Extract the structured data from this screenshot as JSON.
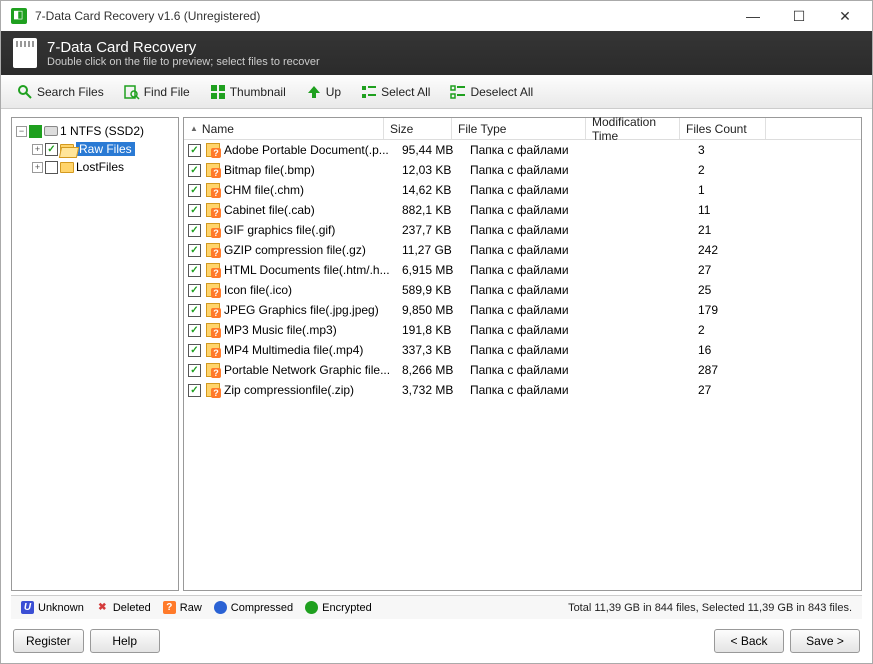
{
  "window": {
    "title": "7-Data Card Recovery v1.6 (Unregistered)"
  },
  "header": {
    "title": "7-Data Card Recovery",
    "subtitle": "Double click on the file to preview; select files to recover"
  },
  "toolbar": {
    "search": "Search Files",
    "find": "Find File",
    "thumbnail": "Thumbnail",
    "up": "Up",
    "select_all": "Select All",
    "deselect_all": "Deselect All"
  },
  "tree": {
    "root": "1 NTFS (SSD2)",
    "raw": "Raw Files",
    "lost": "LostFiles"
  },
  "columns": {
    "name": "Name",
    "size": "Size",
    "type": "File Type",
    "mod": "Modification Time",
    "count": "Files Count"
  },
  "rows": [
    {
      "name": "Adobe Portable Document(.p...",
      "size": "95,44 MB",
      "type": "Папка с файлами",
      "count": "3"
    },
    {
      "name": "Bitmap file(.bmp)",
      "size": "12,03 KB",
      "type": "Папка с файлами",
      "count": "2"
    },
    {
      "name": "CHM file(.chm)",
      "size": "14,62 KB",
      "type": "Папка с файлами",
      "count": "1"
    },
    {
      "name": "Cabinet file(.cab)",
      "size": "882,1 KB",
      "type": "Папка с файлами",
      "count": "11"
    },
    {
      "name": "GIF graphics file(.gif)",
      "size": "237,7 KB",
      "type": "Папка с файлами",
      "count": "21"
    },
    {
      "name": "GZIP compression file(.gz)",
      "size": "11,27 GB",
      "type": "Папка с файлами",
      "count": "242"
    },
    {
      "name": "HTML Documents file(.htm/.h...",
      "size": "6,915 MB",
      "type": "Папка с файлами",
      "count": "27"
    },
    {
      "name": "Icon file(.ico)",
      "size": "589,9 KB",
      "type": "Папка с файлами",
      "count": "25"
    },
    {
      "name": "JPEG Graphics file(.jpg.jpeg)",
      "size": "9,850 MB",
      "type": "Папка с файлами",
      "count": "179"
    },
    {
      "name": "MP3 Music file(.mp3)",
      "size": "191,8 KB",
      "type": "Папка с файлами",
      "count": "2"
    },
    {
      "name": "MP4 Multimedia file(.mp4)",
      "size": "337,3 KB",
      "type": "Папка с файлами",
      "count": "16"
    },
    {
      "name": "Portable Network Graphic file...",
      "size": "8,266 MB",
      "type": "Папка с файлами",
      "count": "287"
    },
    {
      "name": "Zip compressionfile(.zip)",
      "size": "3,732 MB",
      "type": "Папка с файлами",
      "count": "27"
    }
  ],
  "legend": {
    "unknown": "Unknown",
    "deleted": "Deleted",
    "raw": "Raw",
    "compressed": "Compressed",
    "encrypted": "Encrypted",
    "status": "Total 11,39 GB in 844 files, Selected 11,39 GB in 843 files."
  },
  "footer": {
    "register": "Register",
    "help": "Help",
    "back": "< Back",
    "save": "Save >"
  }
}
